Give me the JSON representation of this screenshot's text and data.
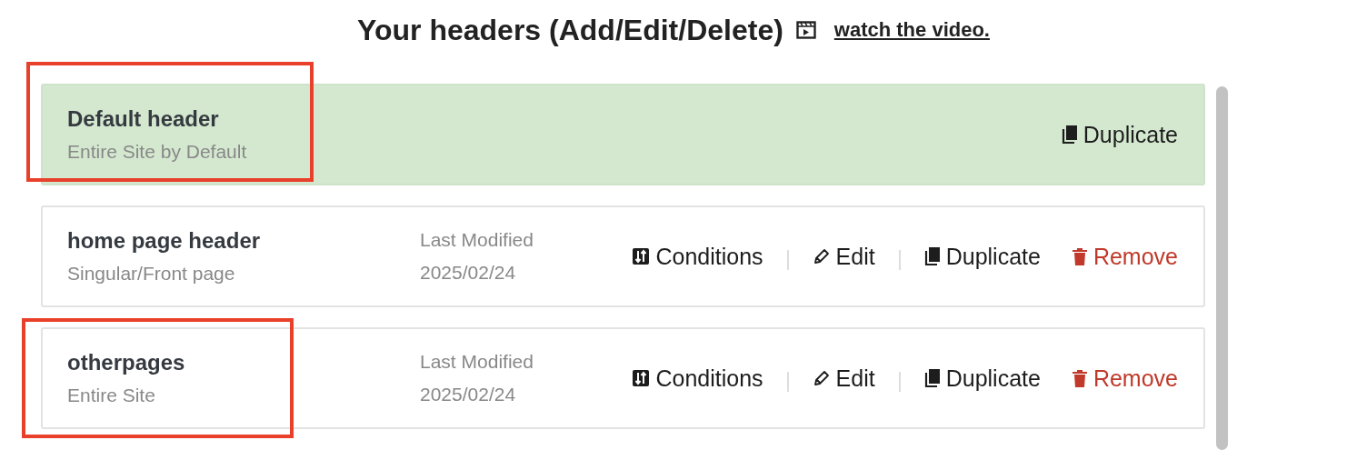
{
  "title": "Your headers (Add/Edit/Delete)",
  "video_link": "watch the video.",
  "headers": [
    {
      "name": "Default header",
      "scope": "Entire Site by Default",
      "default": true,
      "highlighted": true,
      "actions": [
        {
          "kind": "duplicate",
          "label": "Duplicate"
        }
      ]
    },
    {
      "name": "home page header",
      "scope": "Singular/Front page",
      "default": false,
      "highlighted": false,
      "modified_label": "Last Modified",
      "modified_date": "2025/02/24",
      "actions": [
        {
          "kind": "conditions",
          "label": "Conditions"
        },
        {
          "kind": "edit",
          "label": "Edit"
        },
        {
          "kind": "duplicate",
          "label": "Duplicate"
        },
        {
          "kind": "remove",
          "label": "Remove"
        }
      ]
    },
    {
      "name": "otherpages",
      "scope": "Entire Site",
      "default": false,
      "highlighted": true,
      "modified_label": "Last Modified",
      "modified_date": "2025/02/24",
      "actions": [
        {
          "kind": "conditions",
          "label": "Conditions"
        },
        {
          "kind": "edit",
          "label": "Edit"
        },
        {
          "kind": "duplicate",
          "label": "Duplicate"
        },
        {
          "kind": "remove",
          "label": "Remove"
        }
      ]
    }
  ]
}
